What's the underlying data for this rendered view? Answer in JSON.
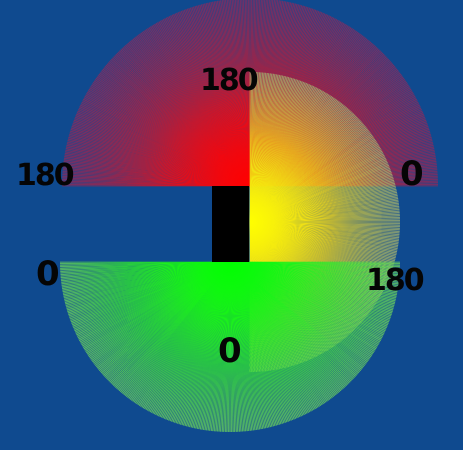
{
  "background_color": "#0f4a8f",
  "fans": [
    {
      "name": "top-left-fan",
      "color_center": "#ff0000",
      "color_edge": "#8a2a5e",
      "sweep_degrees": 180
    },
    {
      "name": "right-fan",
      "color_center": "#ffff00",
      "color_edge": "#9fbf6a",
      "sweep_degrees": 180
    },
    {
      "name": "bottom-fan",
      "color_center": "#00ff00",
      "color_edge": "#6adf52",
      "sweep_degrees": 180
    }
  ],
  "center_block_color": "#000000",
  "labels": {
    "top_center": "180",
    "left_top": "180",
    "right_top": "0",
    "left_mid": "0",
    "right_mid": "180",
    "bottom_center": "0"
  }
}
